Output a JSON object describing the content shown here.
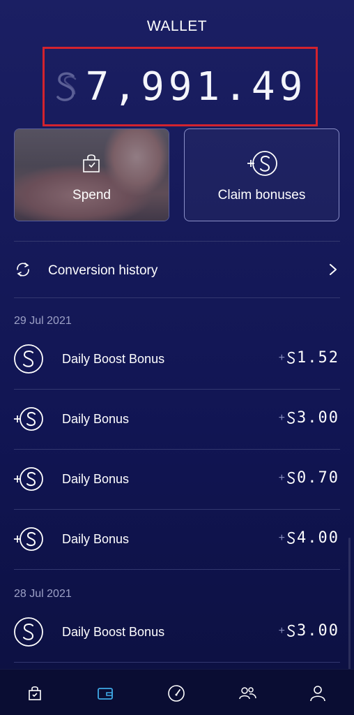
{
  "header": {
    "title": "WALLET"
  },
  "balance": {
    "currency_icon": "sweatcoin-icon",
    "value": "7,991.49"
  },
  "actions": {
    "spend_label": "Spend",
    "spend_icon": "shopping-bag-icon",
    "claim_label": "Claim bonuses",
    "claim_icon": "plus-sweatcoin-icon"
  },
  "conversion": {
    "label": "Conversion history",
    "icon": "refresh-icon",
    "chevron": "chevron-right-icon"
  },
  "groups": [
    {
      "date": "29 Jul 2021",
      "items": [
        {
          "label": "Daily Boost Bonus",
          "sign": "+",
          "amount": "1.52",
          "icon": "sweatcoin-circle-icon"
        },
        {
          "label": "Daily Bonus",
          "sign": "+",
          "amount": "3.00",
          "icon": "plus-sweatcoin-icon"
        },
        {
          "label": "Daily Bonus",
          "sign": "+",
          "amount": "0.70",
          "icon": "plus-sweatcoin-icon"
        },
        {
          "label": "Daily Bonus",
          "sign": "+",
          "amount": "4.00",
          "icon": "plus-sweatcoin-icon"
        }
      ]
    },
    {
      "date": "28 Jul 2021",
      "items": [
        {
          "label": "Daily Boost Bonus",
          "sign": "+",
          "amount": "3.00",
          "icon": "sweatcoin-circle-icon"
        }
      ]
    }
  ],
  "nav": {
    "items": [
      "shop-icon",
      "wallet-icon",
      "speedometer-icon",
      "friends-icon",
      "profile-icon"
    ],
    "active": "wallet-icon"
  },
  "colors": {
    "background": "#161a5a",
    "highlight_border": "#d3232e",
    "active_nav": "#3fa9e6",
    "muted_text": "#9da1c6"
  }
}
